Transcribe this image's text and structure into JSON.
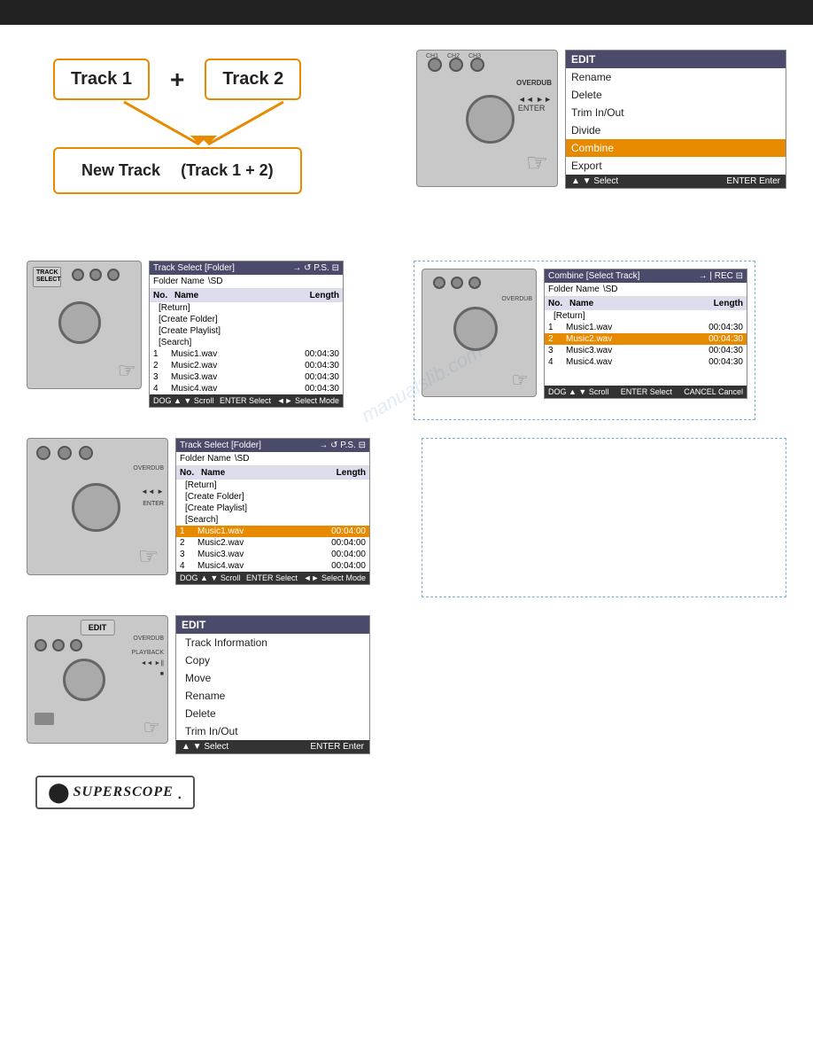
{
  "topBar": {},
  "section1": {
    "track1Label": "Track 1",
    "track2Label": "Track 2",
    "plusSign": "+",
    "newTrackLabel": "New Track",
    "combinedLabel": "(Track 1 + 2)"
  },
  "editMenu": {
    "title": "EDIT",
    "items": [
      {
        "label": "Rename",
        "highlighted": false
      },
      {
        "label": "Delete",
        "highlighted": false
      },
      {
        "label": "Trim In/Out",
        "highlighted": false
      },
      {
        "label": "Divide",
        "highlighted": false
      },
      {
        "label": "Combine",
        "highlighted": true
      },
      {
        "label": "Export",
        "highlighted": false
      }
    ],
    "footer": {
      "left": "▲ ▼ Select",
      "right": "ENTER Enter"
    }
  },
  "trackSelectPanel": {
    "title": "Track Select [Folder]",
    "folderLabel": "Folder Name",
    "folderValue": "\\SD",
    "columns": {
      "no": "No.",
      "name": "Name",
      "length": "Length"
    },
    "items": [
      {
        "no": "",
        "name": "[Return]",
        "length": ""
      },
      {
        "no": "",
        "name": "[Create Folder]",
        "length": ""
      },
      {
        "no": "",
        "name": "[Create Playlist]",
        "length": ""
      },
      {
        "no": "",
        "name": "[Search]",
        "length": ""
      },
      {
        "no": "1",
        "name": "Music1.wav",
        "length": "00:04:30"
      },
      {
        "no": "2",
        "name": "Music2.wav",
        "length": "00:04:30"
      },
      {
        "no": "3",
        "name": "Music3.wav",
        "length": "00:04:30"
      },
      {
        "no": "4",
        "name": "Music4.wav",
        "length": "00:04:30"
      }
    ],
    "footer": {
      "left": "DOG ▲ ▼ Scroll",
      "right": "ENTER Select",
      "extra": "◄► Select Mode"
    },
    "trackSelectBtn": "TRACK\nSELECT"
  },
  "combinePanel": {
    "title": "Combine [Select Track]",
    "folderLabel": "Folder Name",
    "folderValue": "\\SD",
    "columns": {
      "no": "No.",
      "name": "Name",
      "length": "Length"
    },
    "items": [
      {
        "no": "",
        "name": "[Return]",
        "length": "",
        "highlighted": false
      },
      {
        "no": "1",
        "name": "Music1.wav",
        "length": "00:04:30",
        "highlighted": false
      },
      {
        "no": "2",
        "name": "Music2.wav",
        "length": "00:04:30",
        "highlighted": true
      },
      {
        "no": "3",
        "name": "Music3.wav",
        "length": "00:04:30",
        "highlighted": false
      },
      {
        "no": "4",
        "name": "Music4.wav",
        "length": "00:04:30",
        "highlighted": false
      }
    ],
    "footer": {
      "left": "DOG ▲ ▼ Scroll",
      "middle": "ENTER Select",
      "right": "CANCEL Cancel"
    }
  },
  "trackSelectPanel2": {
    "title": "Track Select [Folder]",
    "folderLabel": "Folder Name",
    "folderValue": "\\SD",
    "columns": {
      "no": "No.",
      "name": "Name",
      "length": "Length"
    },
    "items": [
      {
        "no": "",
        "name": "[Return]",
        "length": "",
        "highlighted": false
      },
      {
        "no": "",
        "name": "[Create Folder]",
        "length": "",
        "highlighted": false
      },
      {
        "no": "",
        "name": "[Create Playlist]",
        "length": "",
        "highlighted": false
      },
      {
        "no": "",
        "name": "[Search]",
        "length": "",
        "highlighted": false
      },
      {
        "no": "1",
        "name": "Music1.wav",
        "length": "00:04:00",
        "highlighted": true
      },
      {
        "no": "2",
        "name": "Music2.wav",
        "length": "00:04:00",
        "highlighted": false
      },
      {
        "no": "3",
        "name": "Music3.wav",
        "length": "00:04:00",
        "highlighted": false
      },
      {
        "no": "4",
        "name": "Music4.wav",
        "length": "00:04:00",
        "highlighted": false
      }
    ],
    "footer": {
      "left": "DOG ▲ ▼ Scroll",
      "right": "ENTER Select",
      "extra": "◄► Select Mode"
    }
  },
  "editMenu2": {
    "title": "EDIT",
    "items": [
      {
        "label": "Track Information"
      },
      {
        "label": "Copy"
      },
      {
        "label": "Move"
      },
      {
        "label": "Rename"
      },
      {
        "label": "Delete"
      },
      {
        "label": "Trim In/Out"
      }
    ],
    "footer": {
      "left": "▲ ▼ Select",
      "right": "ENTER Enter"
    },
    "editBtn": "EDIT"
  },
  "logo": {
    "text": "SUPERSCOPE",
    "dot": "."
  },
  "watermark": "manualslib.com"
}
